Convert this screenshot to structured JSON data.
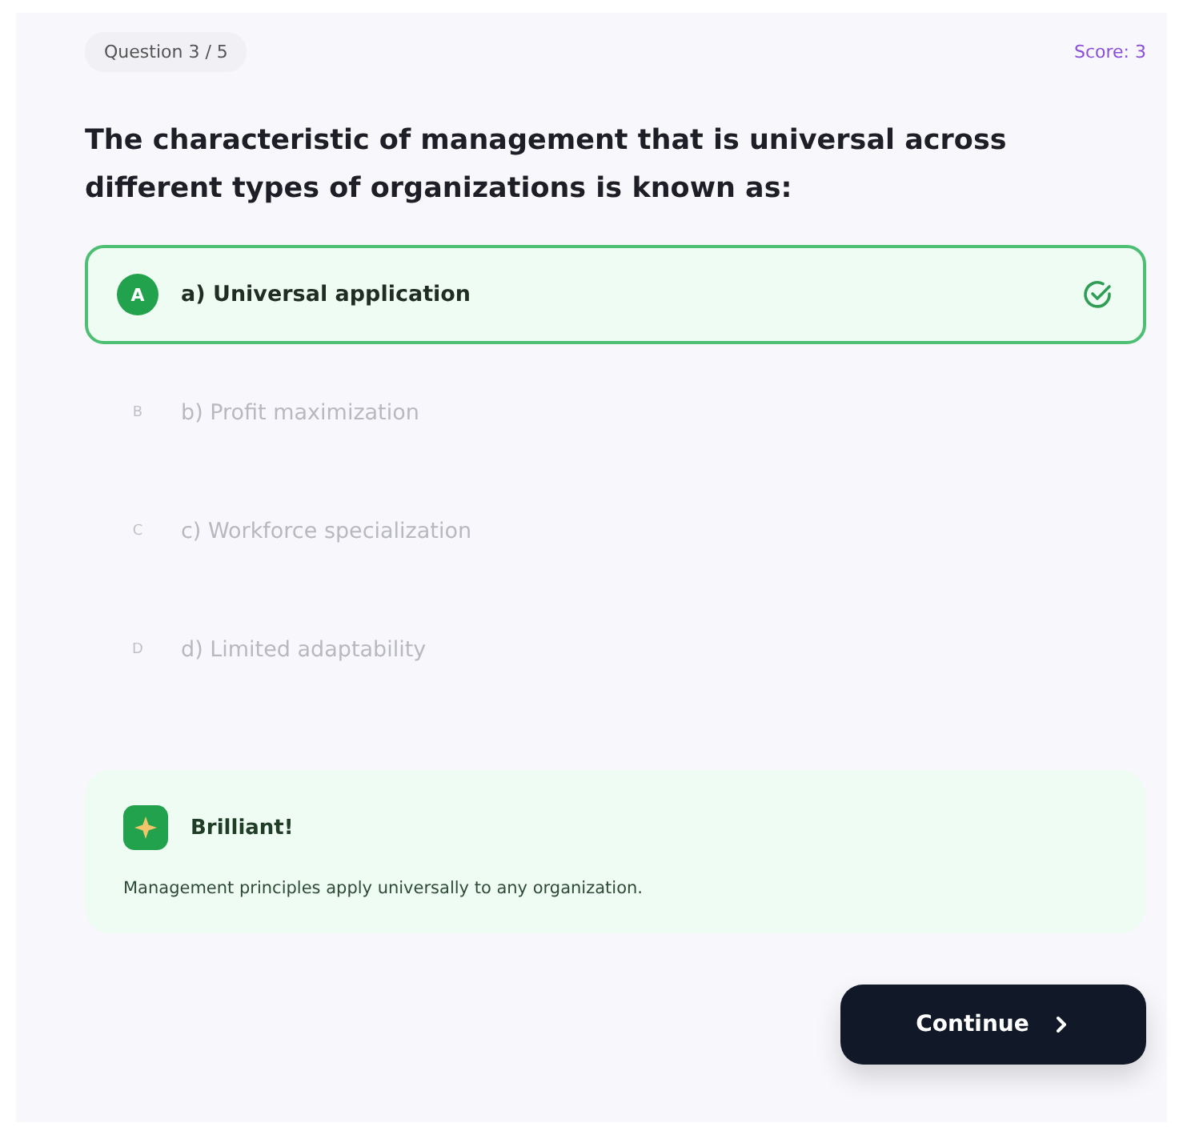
{
  "progress": "Question 3 / 5",
  "score": "Score: 3",
  "question": "The characteristic of management that is universal across different types of organizations is known as:",
  "options": [
    {
      "letter": "A",
      "text": "a) Universal application",
      "selected": true
    },
    {
      "letter": "B",
      "text": "b) Profit maximization",
      "selected": false
    },
    {
      "letter": "C",
      "text": "c) Workforce specialization",
      "selected": false
    },
    {
      "letter": "D",
      "text": "d) Limited adaptability",
      "selected": false
    }
  ],
  "feedback": {
    "title": "Brilliant!",
    "text": "Management principles apply universally to any organization."
  },
  "continue_button": "Continue"
}
